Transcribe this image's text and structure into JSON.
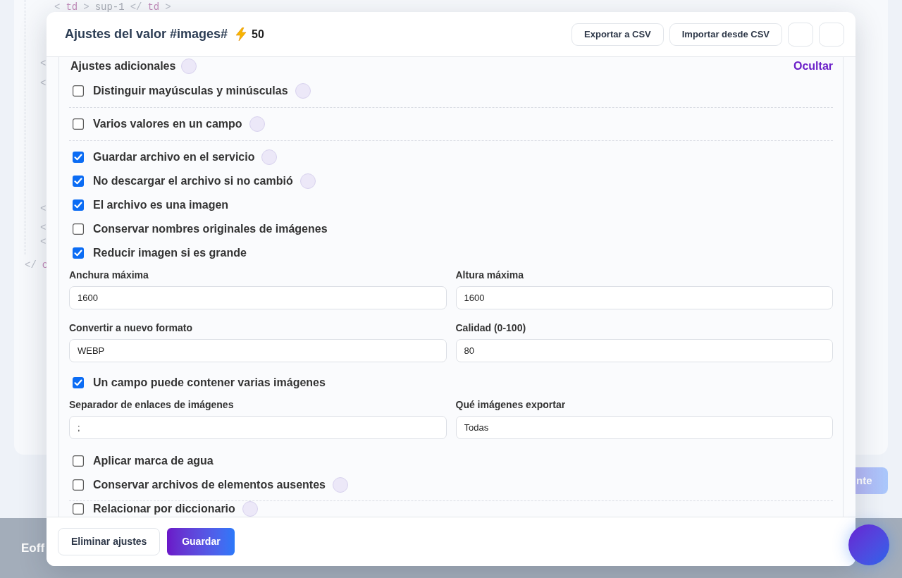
{
  "background": {
    "code_lines": [
      {
        "tokens": [
          {
            "kind": "punct",
            "text": "<"
          },
          {
            "kind": "tag",
            "text": "td"
          },
          {
            "kind": "punct",
            "text": ">"
          },
          {
            "kind": "text",
            "text": "sup-1"
          },
          {
            "kind": "punct",
            "text": "</"
          },
          {
            "kind": "tag",
            "text": "td"
          },
          {
            "kind": "punct",
            "text": ">"
          }
        ]
      },
      {
        "tokens": [
          {
            "kind": "punct",
            "text": "<"
          }
        ]
      },
      {
        "tokens": [
          {
            "kind": "punct",
            "text": "<"
          }
        ]
      },
      {
        "tokens": [
          {
            "kind": "punct",
            "text": "<"
          }
        ]
      },
      {
        "tokens": [
          {
            "kind": "punct",
            "text": "<"
          }
        ]
      },
      {
        "tokens": [
          {
            "kind": "punct",
            "text": "<"
          }
        ]
      },
      {
        "tokens": [
          {
            "kind": "punct",
            "text": "</"
          },
          {
            "kind": "tag",
            "text": "c"
          }
        ]
      }
    ],
    "next_button": "nte",
    "footer_text": "Eoff"
  },
  "modal": {
    "title": "Ajustes del valor #images#",
    "credits": "50",
    "header_buttons": [
      {
        "kind": "text",
        "label": "Exportar a CSV"
      },
      {
        "kind": "text",
        "label": "Importar desde CSV"
      },
      {
        "kind": "square"
      },
      {
        "kind": "square"
      }
    ],
    "section": {
      "title": "Ajustes adicionales",
      "info": true,
      "toggle_link": "Ocultar"
    },
    "items": [
      {
        "kind": "checkbox",
        "label": "Distinguir mayúsculas y minúsculas",
        "checked": false,
        "info": true
      },
      {
        "kind": "divider"
      },
      {
        "kind": "checkbox",
        "label": "Varios valores en un campo",
        "checked": false,
        "info": true
      },
      {
        "kind": "divider"
      },
      {
        "kind": "checkbox",
        "label": "Guardar archivo en el servicio",
        "checked": true,
        "info": true
      },
      {
        "kind": "checkbox",
        "label": "No descargar el archivo si no cambió",
        "checked": true,
        "info": true
      },
      {
        "kind": "checkbox",
        "label": "El archivo es una imagen",
        "checked": true,
        "info": false
      },
      {
        "kind": "checkbox",
        "label": "Conservar nombres originales de imágenes",
        "checked": false,
        "info": false
      },
      {
        "kind": "checkbox",
        "label": "Reducir imagen si es grande",
        "checked": true,
        "info": false
      },
      {
        "kind": "fields",
        "fields": [
          {
            "label": "Anchura máxima",
            "value": "1600"
          },
          {
            "label": "Altura máxima",
            "value": "1600"
          }
        ]
      },
      {
        "kind": "fields",
        "fields": [
          {
            "label": "Convertir a nuevo formato",
            "value": "WEBP"
          },
          {
            "label": "Calidad (0-100)",
            "value": "80"
          }
        ]
      },
      {
        "kind": "checkbox",
        "label": "Un campo puede contener varias imágenes",
        "checked": true,
        "info": false
      },
      {
        "kind": "fields",
        "fields": [
          {
            "label": "Separador de enlaces de imágenes",
            "value": ";"
          },
          {
            "label": "Qué imágenes exportar",
            "value": "Todas"
          }
        ]
      },
      {
        "kind": "checkbox",
        "label": "Aplicar marca de agua",
        "checked": false,
        "info": false
      },
      {
        "kind": "checkbox",
        "label": "Conservar archivos de elementos ausentes",
        "checked": false,
        "info": true
      },
      {
        "kind": "divider"
      },
      {
        "kind": "checkbox",
        "label": "Relacionar por diccionario",
        "checked": false,
        "info": true
      }
    ],
    "footer_buttons": [
      {
        "kind": "secondary",
        "label": "Eliminar ajustes"
      },
      {
        "kind": "primary",
        "label": "Guardar"
      }
    ]
  }
}
